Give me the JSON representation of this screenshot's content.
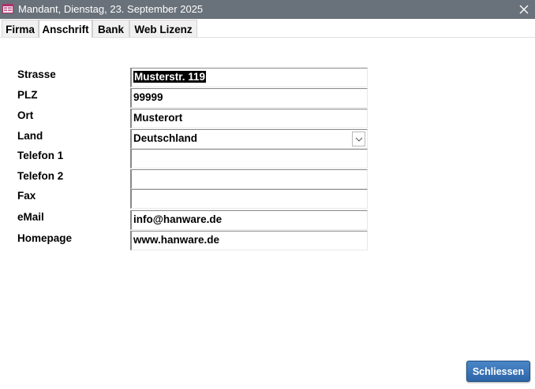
{
  "window": {
    "title": "Mandant, Dienstag, 23. September 2025",
    "close_glyph": "✕"
  },
  "tabs": [
    {
      "label": "Firma",
      "active": false
    },
    {
      "label": "Anschrift",
      "active": true
    },
    {
      "label": "Bank",
      "active": false
    },
    {
      "label": "Web Lizenz",
      "active": false
    }
  ],
  "form": {
    "strasse": {
      "label": "Strasse",
      "value": "Musterstr. 119"
    },
    "plz": {
      "label": "PLZ",
      "value": "99999"
    },
    "ort": {
      "label": "Ort",
      "value": "Musterort"
    },
    "land": {
      "label": "Land",
      "value": "Deutschland"
    },
    "telefon1": {
      "label": "Telefon 1",
      "value": ""
    },
    "telefon2": {
      "label": "Telefon 2",
      "value": ""
    },
    "fax": {
      "label": "Fax",
      "value": ""
    },
    "email": {
      "label": "eMail",
      "value": "info@hanware.de"
    },
    "homepage": {
      "label": "Homepage",
      "value": "www.hanware.de"
    }
  },
  "footer": {
    "close_label": "Schliessen"
  },
  "colors": {
    "titlebar": "#69717a",
    "button": "#3a76b8"
  }
}
